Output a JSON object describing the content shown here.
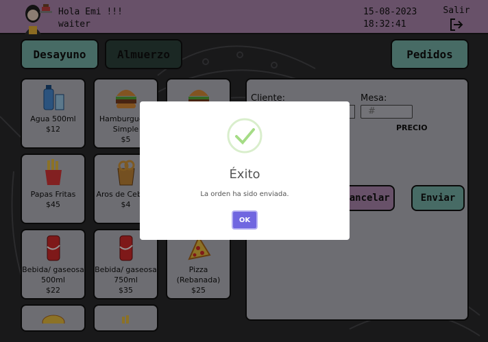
{
  "header": {
    "greeting": "Hola Emi !!!",
    "role": "waiter",
    "date": "15-08-2023",
    "time": "18:32:41",
    "logout_label": "Salir"
  },
  "categories": {
    "desayuno": "Desayuno",
    "almuerzo": "Almuerzo",
    "pedidos": "Pedidos"
  },
  "menu": {
    "items": [
      {
        "name": "Agua 500ml",
        "price": "$12",
        "icon": "water-bottle-icon"
      },
      {
        "name": "Hamburguesa Simple",
        "price": "$5",
        "icon": "burger-icon"
      },
      {
        "name": "",
        "price": "",
        "icon": "burger-icon"
      },
      {
        "name": "Papas Fritas",
        "price": "$45",
        "icon": "fries-icon"
      },
      {
        "name": "Aros de Cebolla",
        "price": "$4",
        "icon": "onion-rings-icon"
      },
      {
        "name": "Bebida/ gaseosa 500ml",
        "price": "$22",
        "icon": "soda-can-icon"
      },
      {
        "name": "Bebida/ gaseosa 750ml",
        "price": "$35",
        "icon": "soda-can-icon"
      },
      {
        "name": "Pizza (Rebanada)",
        "price": "$25",
        "icon": "pizza-slice-icon"
      }
    ]
  },
  "order": {
    "cliente_label": "Cliente:",
    "mesa_label": "Mesa:",
    "mesa_placeholder": "#",
    "precio_label": "PRECIO",
    "cancel_label": "Cancelar",
    "send_label": "Enviar"
  },
  "modal": {
    "title": "Éxito",
    "message": "La orden ha sido enviada.",
    "ok_label": "OK"
  },
  "colors": {
    "header_bg": "#b48cb5",
    "teal": "#7bb8ae",
    "dark_green": "#30463f",
    "tile_bg": "#bcbcc4",
    "ok_button": "#7066e0",
    "success": "#a5dc86"
  }
}
